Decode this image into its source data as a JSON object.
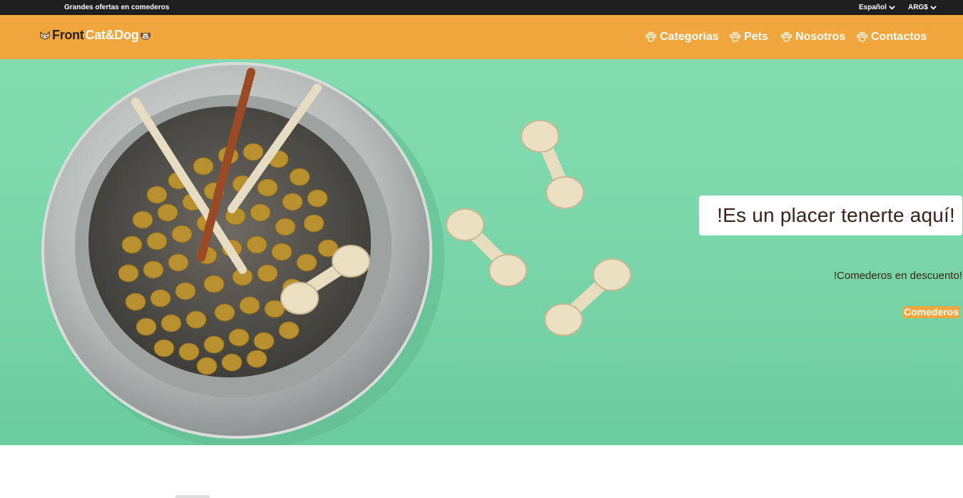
{
  "topbar": {
    "promo": "Grandes ofertas en comederos",
    "language": "Español",
    "currency": "ARG$"
  },
  "brand": {
    "word1": "Front",
    "word2": "Cat&Dog"
  },
  "nav": [
    {
      "label": "Categorías"
    },
    {
      "label": "Pets"
    },
    {
      "label": "Nosotros"
    },
    {
      "label": "Contactos"
    }
  ],
  "hero": {
    "headline": "!Es un placer tenerte aquí!",
    "subline": "!Comederos en descuento!",
    "cta": "Comederos"
  },
  "colors": {
    "topbar": "#1e1e1e",
    "nav": "#f0a63c",
    "hero": "#7ad6aa",
    "text_dark": "#3a2319"
  }
}
